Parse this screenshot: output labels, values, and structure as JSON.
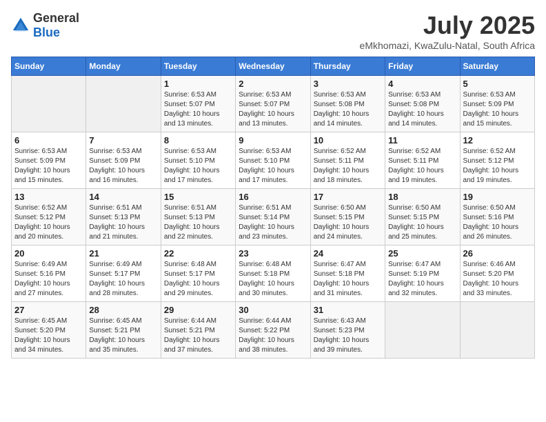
{
  "header": {
    "logo_general": "General",
    "logo_blue": "Blue",
    "title": "July 2025",
    "subtitle": "eMkhomazi, KwaZulu-Natal, South Africa"
  },
  "calendar": {
    "days_of_week": [
      "Sunday",
      "Monday",
      "Tuesday",
      "Wednesday",
      "Thursday",
      "Friday",
      "Saturday"
    ],
    "weeks": [
      [
        {
          "day": "",
          "info": ""
        },
        {
          "day": "",
          "info": ""
        },
        {
          "day": "1",
          "info": "Sunrise: 6:53 AM\nSunset: 5:07 PM\nDaylight: 10 hours and 13 minutes."
        },
        {
          "day": "2",
          "info": "Sunrise: 6:53 AM\nSunset: 5:07 PM\nDaylight: 10 hours and 13 minutes."
        },
        {
          "day": "3",
          "info": "Sunrise: 6:53 AM\nSunset: 5:08 PM\nDaylight: 10 hours and 14 minutes."
        },
        {
          "day": "4",
          "info": "Sunrise: 6:53 AM\nSunset: 5:08 PM\nDaylight: 10 hours and 14 minutes."
        },
        {
          "day": "5",
          "info": "Sunrise: 6:53 AM\nSunset: 5:09 PM\nDaylight: 10 hours and 15 minutes."
        }
      ],
      [
        {
          "day": "6",
          "info": "Sunrise: 6:53 AM\nSunset: 5:09 PM\nDaylight: 10 hours and 15 minutes."
        },
        {
          "day": "7",
          "info": "Sunrise: 6:53 AM\nSunset: 5:09 PM\nDaylight: 10 hours and 16 minutes."
        },
        {
          "day": "8",
          "info": "Sunrise: 6:53 AM\nSunset: 5:10 PM\nDaylight: 10 hours and 17 minutes."
        },
        {
          "day": "9",
          "info": "Sunrise: 6:53 AM\nSunset: 5:10 PM\nDaylight: 10 hours and 17 minutes."
        },
        {
          "day": "10",
          "info": "Sunrise: 6:52 AM\nSunset: 5:11 PM\nDaylight: 10 hours and 18 minutes."
        },
        {
          "day": "11",
          "info": "Sunrise: 6:52 AM\nSunset: 5:11 PM\nDaylight: 10 hours and 19 minutes."
        },
        {
          "day": "12",
          "info": "Sunrise: 6:52 AM\nSunset: 5:12 PM\nDaylight: 10 hours and 19 minutes."
        }
      ],
      [
        {
          "day": "13",
          "info": "Sunrise: 6:52 AM\nSunset: 5:12 PM\nDaylight: 10 hours and 20 minutes."
        },
        {
          "day": "14",
          "info": "Sunrise: 6:51 AM\nSunset: 5:13 PM\nDaylight: 10 hours and 21 minutes."
        },
        {
          "day": "15",
          "info": "Sunrise: 6:51 AM\nSunset: 5:13 PM\nDaylight: 10 hours and 22 minutes."
        },
        {
          "day": "16",
          "info": "Sunrise: 6:51 AM\nSunset: 5:14 PM\nDaylight: 10 hours and 23 minutes."
        },
        {
          "day": "17",
          "info": "Sunrise: 6:50 AM\nSunset: 5:15 PM\nDaylight: 10 hours and 24 minutes."
        },
        {
          "day": "18",
          "info": "Sunrise: 6:50 AM\nSunset: 5:15 PM\nDaylight: 10 hours and 25 minutes."
        },
        {
          "day": "19",
          "info": "Sunrise: 6:50 AM\nSunset: 5:16 PM\nDaylight: 10 hours and 26 minutes."
        }
      ],
      [
        {
          "day": "20",
          "info": "Sunrise: 6:49 AM\nSunset: 5:16 PM\nDaylight: 10 hours and 27 minutes."
        },
        {
          "day": "21",
          "info": "Sunrise: 6:49 AM\nSunset: 5:17 PM\nDaylight: 10 hours and 28 minutes."
        },
        {
          "day": "22",
          "info": "Sunrise: 6:48 AM\nSunset: 5:17 PM\nDaylight: 10 hours and 29 minutes."
        },
        {
          "day": "23",
          "info": "Sunrise: 6:48 AM\nSunset: 5:18 PM\nDaylight: 10 hours and 30 minutes."
        },
        {
          "day": "24",
          "info": "Sunrise: 6:47 AM\nSunset: 5:18 PM\nDaylight: 10 hours and 31 minutes."
        },
        {
          "day": "25",
          "info": "Sunrise: 6:47 AM\nSunset: 5:19 PM\nDaylight: 10 hours and 32 minutes."
        },
        {
          "day": "26",
          "info": "Sunrise: 6:46 AM\nSunset: 5:20 PM\nDaylight: 10 hours and 33 minutes."
        }
      ],
      [
        {
          "day": "27",
          "info": "Sunrise: 6:45 AM\nSunset: 5:20 PM\nDaylight: 10 hours and 34 minutes."
        },
        {
          "day": "28",
          "info": "Sunrise: 6:45 AM\nSunset: 5:21 PM\nDaylight: 10 hours and 35 minutes."
        },
        {
          "day": "29",
          "info": "Sunrise: 6:44 AM\nSunset: 5:21 PM\nDaylight: 10 hours and 37 minutes."
        },
        {
          "day": "30",
          "info": "Sunrise: 6:44 AM\nSunset: 5:22 PM\nDaylight: 10 hours and 38 minutes."
        },
        {
          "day": "31",
          "info": "Sunrise: 6:43 AM\nSunset: 5:23 PM\nDaylight: 10 hours and 39 minutes."
        },
        {
          "day": "",
          "info": ""
        },
        {
          "day": "",
          "info": ""
        }
      ]
    ]
  }
}
